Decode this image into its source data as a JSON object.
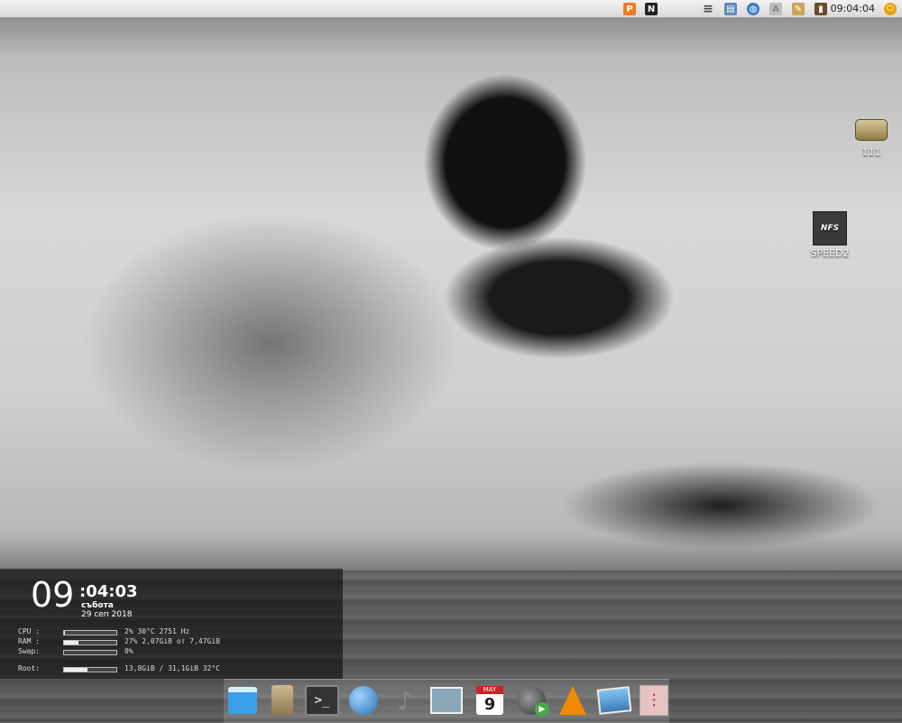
{
  "top_panel": {
    "clock": "09:04:04",
    "tray_icons": [
      {
        "name": "pidgin-icon",
        "glyph": "P",
        "color": "#ee7b23"
      },
      {
        "name": "notepad-icon",
        "glyph": "N",
        "color": "#222222"
      },
      {
        "name": "menu-list-icon",
        "glyph": "≡",
        "color": "#555555"
      },
      {
        "name": "calendar-icon",
        "glyph": "▤",
        "color": "#5a8bb8"
      },
      {
        "name": "network-globe-icon",
        "glyph": "◍",
        "color": "#3a7cc2"
      },
      {
        "name": "keyboard-layout-icon",
        "glyph": "A",
        "color": "#bdbdbd"
      },
      {
        "name": "clipboard-icon",
        "glyph": "✎",
        "color": "#c9a552"
      },
      {
        "name": "battery-icon",
        "glyph": "▮",
        "color": "#6a4a2a"
      }
    ],
    "power_icon": "power-icon"
  },
  "desktop_icons": [
    {
      "label": "111",
      "icon": "drive-icon"
    },
    {
      "label": "SPEED2",
      "icon": "nfs-icon",
      "logo_text": "NFS"
    }
  ],
  "conky": {
    "hour": "09",
    "minutes": ":04:03",
    "day": "събота",
    "date": "29 сеп 2018",
    "stats": [
      {
        "label": "CPU :",
        "fill": 0.02,
        "text": "2%  30°C 2751 Hz"
      },
      {
        "label": "RAM :",
        "fill": 0.27,
        "text": "27% 2,07GiB от 7,47GiB"
      },
      {
        "label": "Swap:",
        "fill": 0.0,
        "text": "0%"
      },
      {
        "label": "Root:",
        "fill": 0.44,
        "text": "13,8GiB / 31,1GiB 32°C"
      }
    ]
  },
  "dock": {
    "items": [
      {
        "name": "file-manager-icon",
        "glyph": "▭",
        "color": "#3aa0e8"
      },
      {
        "name": "archive-icon",
        "glyph": "▦",
        "color": "#b9a27a"
      },
      {
        "name": "terminal-icon",
        "glyph": ">_",
        "color": "#444444"
      },
      {
        "name": "web-browser-icon",
        "glyph": "◍",
        "color": "#4a8fc8"
      },
      {
        "name": "music-player-icon",
        "glyph": "♪",
        "color": "#777777"
      },
      {
        "name": "screenshot-icon",
        "glyph": "▣",
        "color": "#8aa7b8"
      },
      {
        "name": "calendar-dock-icon",
        "glyph": "9",
        "color": "#ffffff",
        "month": "MAY"
      },
      {
        "name": "video-player-icon",
        "glyph": "▶",
        "color": "#4aa84a"
      },
      {
        "name": "vlc-icon",
        "glyph": "▲",
        "color": "#f08a00"
      },
      {
        "name": "image-viewer-icon",
        "glyph": "▨",
        "color": "#5a9fd6"
      },
      {
        "name": "mixer-settings-icon",
        "glyph": "⫶",
        "color": "#d89a9a"
      }
    ]
  }
}
